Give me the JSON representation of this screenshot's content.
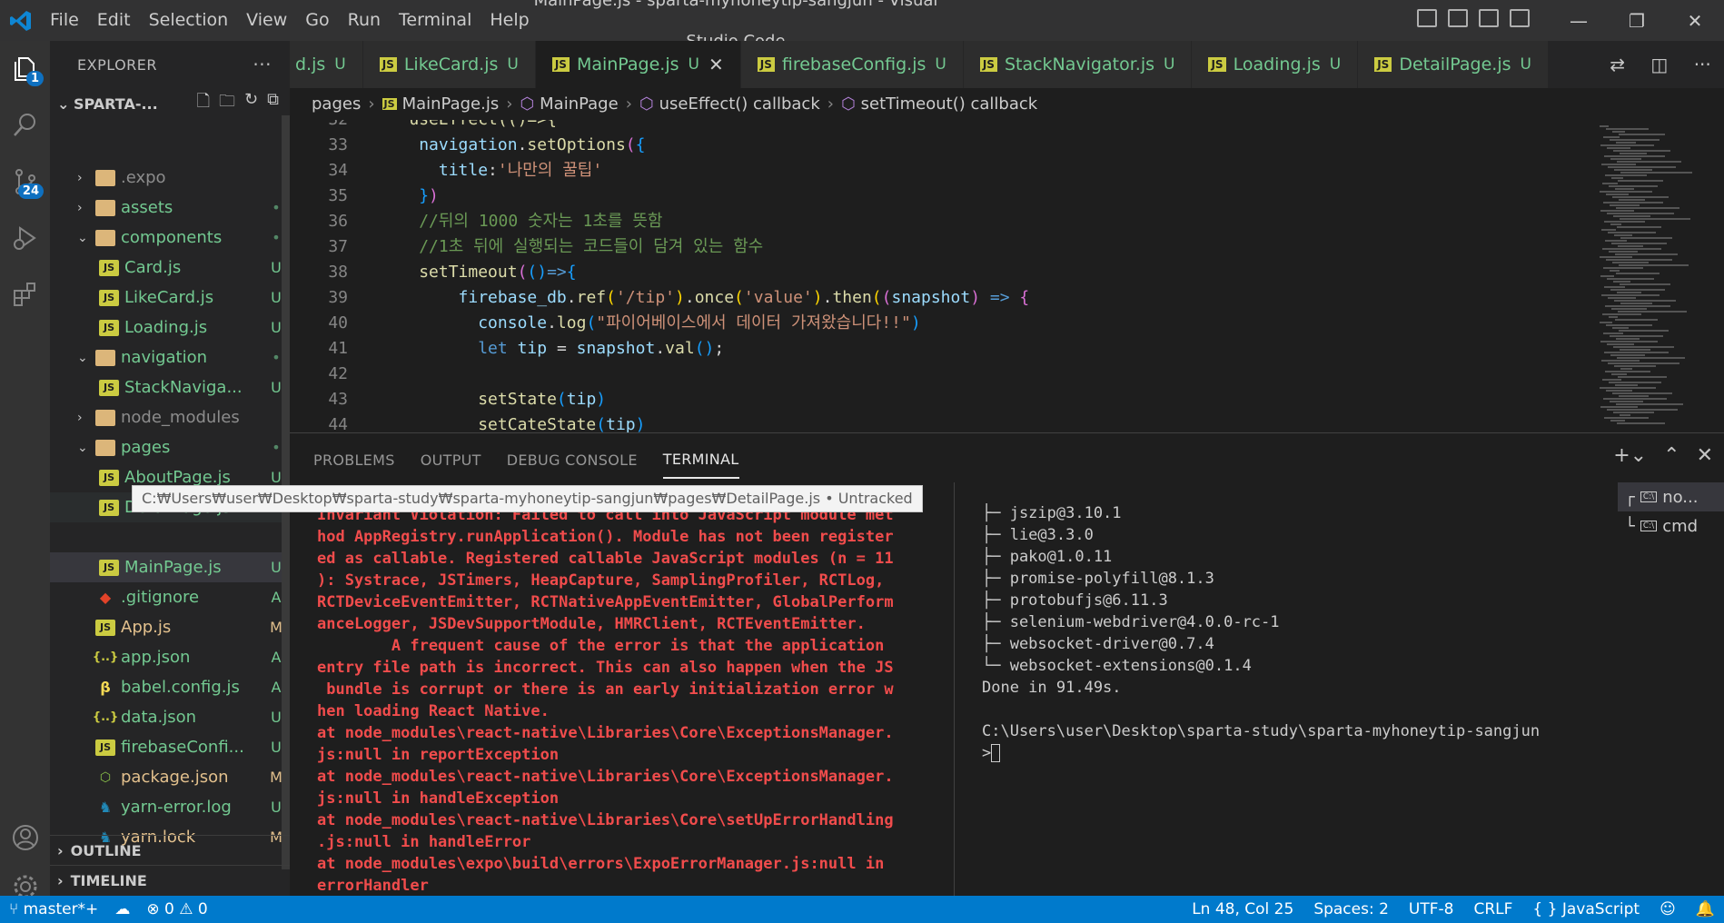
{
  "window": {
    "title": "MainPage.js - sparta-myhoneytip-sangjun - Visual Studio Code",
    "menu": [
      "File",
      "Edit",
      "Selection",
      "View",
      "Go",
      "Run",
      "Terminal",
      "Help"
    ]
  },
  "activity": {
    "scm_badge": "24",
    "explorer_badge": "1"
  },
  "sidebar": {
    "title": "EXPLORER",
    "project": "SPARTA-...",
    "items": [
      {
        "name": ".expo",
        "status": ""
      },
      {
        "name": "assets",
        "status": "•"
      },
      {
        "name": "components",
        "status": "•"
      },
      {
        "name": "Card.js",
        "status": "U"
      },
      {
        "name": "LikeCard.js",
        "status": "U"
      },
      {
        "name": "Loading.js",
        "status": "U"
      },
      {
        "name": "navigation",
        "status": "•"
      },
      {
        "name": "StackNaviga...",
        "status": "U"
      },
      {
        "name": "node_modules",
        "status": ""
      },
      {
        "name": "pages",
        "status": "•"
      },
      {
        "name": "AboutPage.js",
        "status": "U"
      },
      {
        "name": "DetailPage.js",
        "status": "U"
      },
      {
        "name": "MainPage.js",
        "status": "U"
      },
      {
        "name": ".gitignore",
        "status": "A"
      },
      {
        "name": "App.js",
        "status": "M"
      },
      {
        "name": "app.json",
        "status": "A"
      },
      {
        "name": "babel.config.js",
        "status": "A"
      },
      {
        "name": "data.json",
        "status": "U"
      },
      {
        "name": "firebaseConfi...",
        "status": "U"
      },
      {
        "name": "package.json",
        "status": "M"
      },
      {
        "name": "yarn-error.log",
        "status": "U"
      },
      {
        "name": "yarn.lock",
        "status": "M"
      }
    ],
    "outline": "OUTLINE",
    "timeline": "TIMELINE"
  },
  "tooltip": "C:₩Users₩user₩Desktop₩sparta-study₩sparta-myhoneytip-sangjun₩pages₩DetailPage.js • Untracked",
  "tabs": [
    {
      "label": "d.js",
      "status": "U"
    },
    {
      "label": "LikeCard.js",
      "status": "U"
    },
    {
      "label": "MainPage.js",
      "status": "U"
    },
    {
      "label": "firebaseConfig.js",
      "status": "U"
    },
    {
      "label": "StackNavigator.js",
      "status": "U"
    },
    {
      "label": "Loading.js",
      "status": "U"
    },
    {
      "label": "DetailPage.js",
      "status": "U"
    }
  ],
  "breadcrumb": [
    "pages",
    "MainPage.js",
    "MainPage",
    "useEffect() callback",
    "setTimeout() callback"
  ],
  "editor": {
    "line_numbers": [
      "32",
      "33",
      "34",
      "35",
      "36",
      "37",
      "38",
      "39",
      "40",
      "41",
      "42",
      "43",
      "44"
    ],
    "l32": "useEffect(()=>{",
    "l34_str": "'나만의 꿀팁'",
    "l36": "//뒤의 1000 숫자는 1초를 뜻함",
    "l37": "//1초 뒤에 실행되는 코드들이 담겨 있는 함수",
    "l39_path": "'/tip'",
    "l39_val": "'value'",
    "l40_str": "\"파이어베이스에서 데이터 가져왔습니다!!\""
  },
  "panel": {
    "tabs": [
      "PROBLEMS",
      "OUTPUT",
      "DEBUG CONSOLE",
      "TERMINAL"
    ],
    "term_left": "Invariant Violation: Failed to call into JavaScript module met\nhod AppRegistry.runApplication(). Module has not been register\ned as callable. Registered callable JavaScript modules (n = 11\n): Systrace, JSTimers, HeapCapture, SamplingProfiler, RCTLog,\nRCTDeviceEventEmitter, RCTNativeAppEventEmitter, GlobalPerform\nanceLogger, JSDevSupportModule, HMRClient, RCTEventEmitter.\n        A frequent cause of the error is that the application\nentry file path is incorrect. This can also happen when the JS\n bundle is corrupt or there is an early initialization error w\nhen loading React Native.\nat node_modules\\react-native\\Libraries\\Core\\ExceptionsManager.\njs:null in reportException\nat node_modules\\react-native\\Libraries\\Core\\ExceptionsManager.\njs:null in handleException\nat node_modules\\react-native\\Libraries\\Core\\setUpErrorHandling\n.js:null in handleError\nat node_modules\\expo\\build\\errors\\ExpoErrorManager.js:null in\nerrorHandler",
    "term_right": "├─ jszip@3.10.1\n├─ lie@3.3.0\n├─ pako@1.0.11\n├─ promise-polyfill@8.1.3\n├─ protobufjs@6.11.3\n├─ selenium-webdriver@4.0.0-rc-1\n├─ websocket-driver@0.7.4\n└─ websocket-extensions@0.1.4\nDone in 91.49s.\n\nC:\\Users\\user\\Desktop\\sparta-study\\sparta-myhoneytip-sangjun\n>",
    "terminals": [
      "no...",
      "cmd"
    ]
  },
  "status": {
    "branch": "master*+",
    "errors": "0",
    "warnings": "0",
    "position": "Ln 48, Col 25",
    "spaces": "Spaces: 2",
    "encoding": "UTF-8",
    "eol": "CRLF",
    "language": "JavaScript"
  },
  "colors": {
    "accent": "#007acc",
    "untracked": "#73c991",
    "modified": "#e2c08d",
    "error": "#f14c4c"
  }
}
